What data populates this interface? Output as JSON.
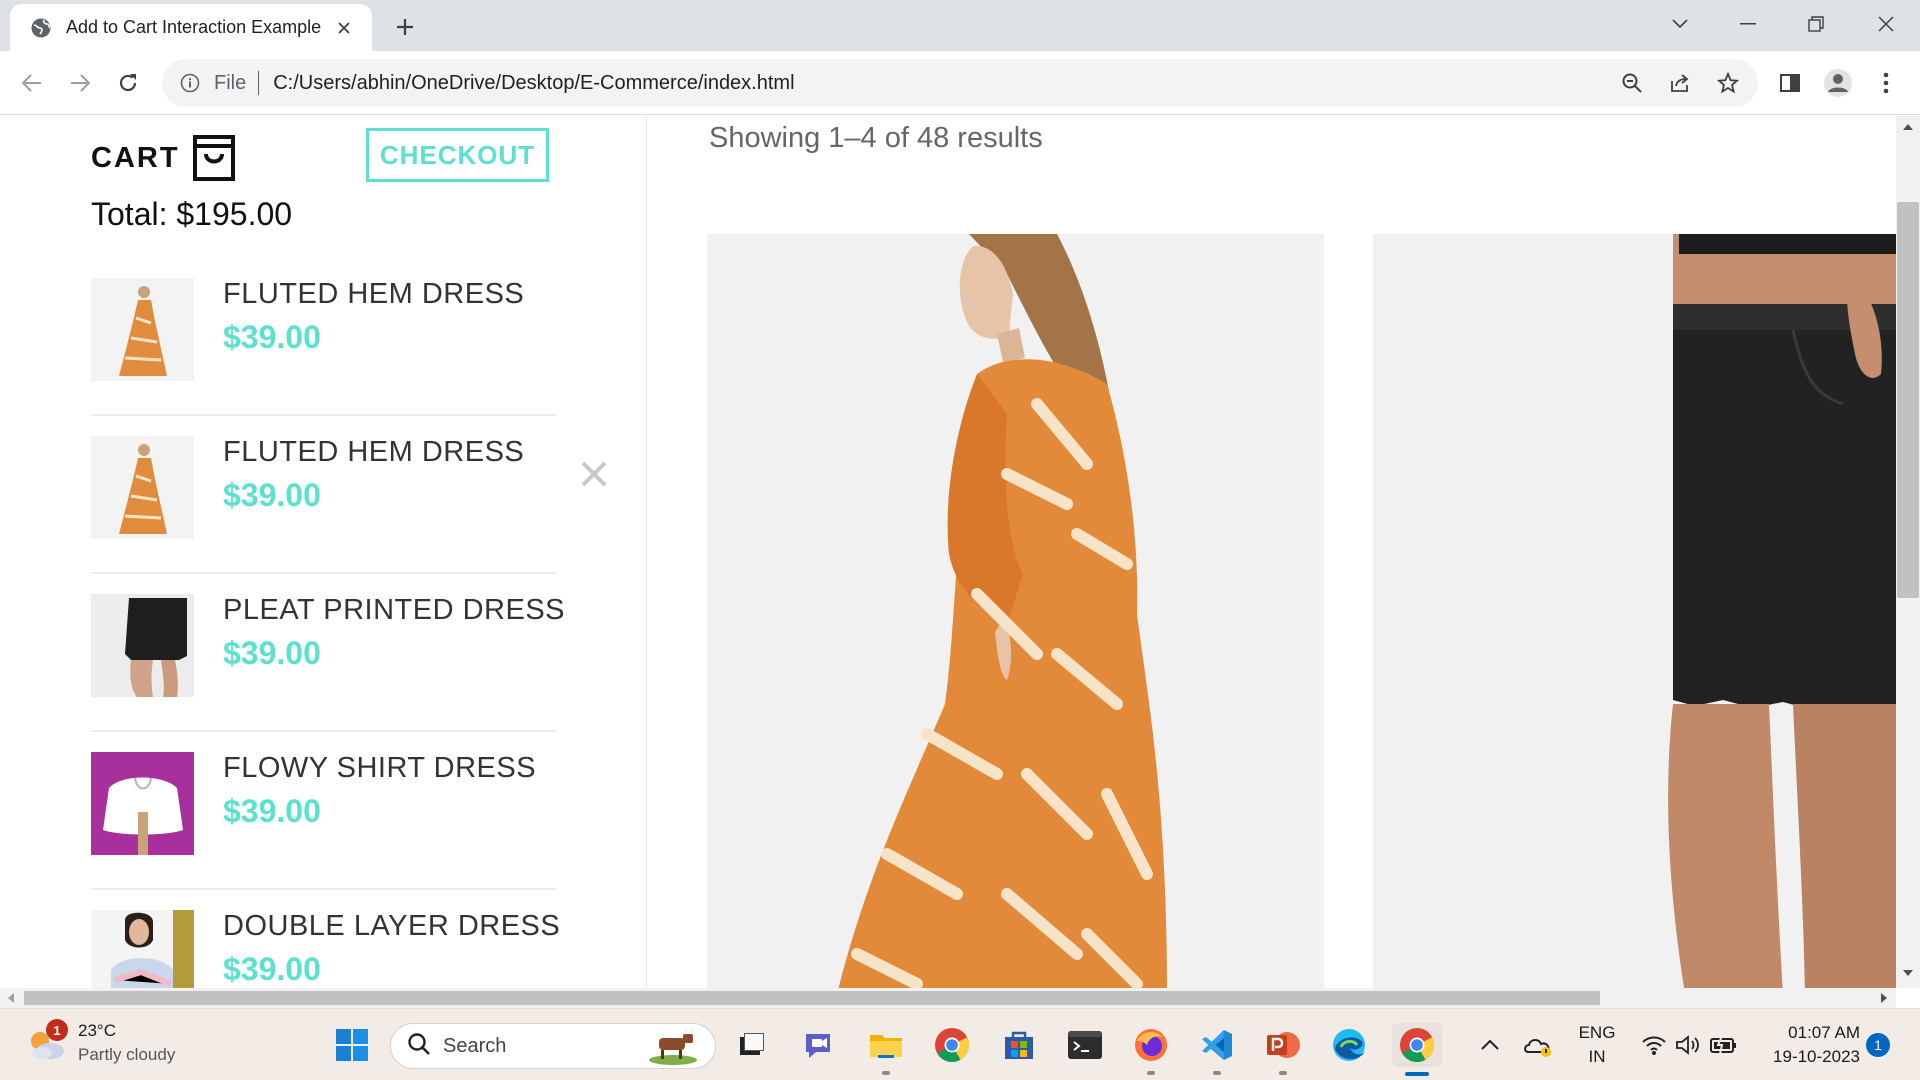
{
  "browser": {
    "tab_title": "Add to Cart Interaction Example",
    "omnibox_scheme": "File",
    "url": "C:/Users/abhin/OneDrive/Desktop/E-Commerce/index.html"
  },
  "cart": {
    "title": "CART",
    "checkout_label": "CHECKOUT",
    "total": "Total: $195.00",
    "items": [
      {
        "name": "FLUTED HEM DRESS",
        "price": "$39.00",
        "thumb": "orange-dress"
      },
      {
        "name": "FLUTED HEM DRESS",
        "price": "$39.00",
        "thumb": "orange-dress"
      },
      {
        "name": "PLEAT PRINTED DRESS",
        "price": "$39.00",
        "thumb": "black-skirt"
      },
      {
        "name": "FLOWY SHIRT DRESS",
        "price": "$39.00",
        "thumb": "white-shirt"
      },
      {
        "name": "DOUBLE LAYER DRESS",
        "price": "$39.00",
        "thumb": "pastel-dress"
      }
    ]
  },
  "shop": {
    "results_text": "Showing 1–4 of 48 results"
  },
  "taskbar": {
    "weather_temp": "23°C",
    "weather_condition": "Partly cloudy",
    "weather_badge": "1",
    "search_label": "Search",
    "lang_line1": "ENG",
    "lang_line2": "IN",
    "time": "01:07 AM",
    "date": "19-10-2023",
    "notification_count": "1"
  },
  "colors": {
    "accent": "#5ce1cf",
    "tabbar_bg": "#dee1e6",
    "taskbar_bg": "#f3ece6"
  }
}
